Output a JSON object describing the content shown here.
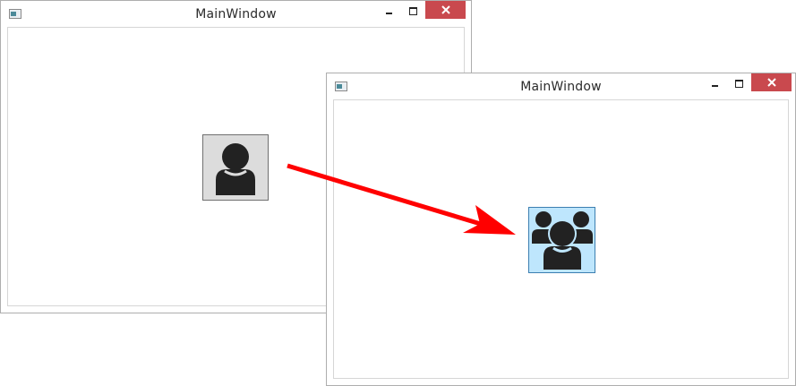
{
  "window_before": {
    "title": "MainWindow",
    "button_icon": "user-icon"
  },
  "window_after": {
    "title": "MainWindow",
    "button_icon": "users-group-icon"
  },
  "arrow": {
    "color": "#ff0000"
  },
  "colors": {
    "close_button": "#c9494e",
    "button_default_bg": "#dcdcdc",
    "button_hover_bg": "#bee6fd",
    "button_hover_border": "#3c7fb1",
    "icon_fill": "#222222"
  }
}
